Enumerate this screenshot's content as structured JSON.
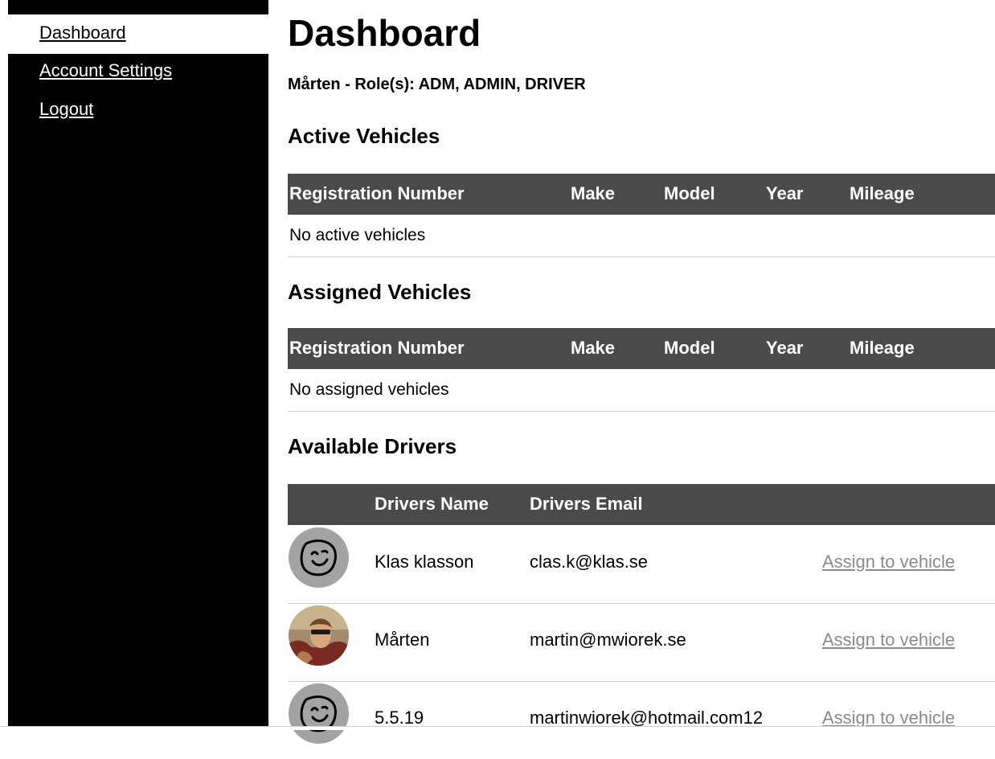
{
  "sidebar": {
    "items": [
      {
        "label": "Dashboard",
        "active": true
      },
      {
        "label": "Account Settings",
        "active": false
      },
      {
        "label": "Logout",
        "active": false
      }
    ]
  },
  "page": {
    "title": "Dashboard",
    "user_roles": "Mårten - Role(s): ADM, ADMIN, DRIVER"
  },
  "active_vehicles": {
    "heading": "Active Vehicles",
    "columns": [
      "Registration Number",
      "Make",
      "Model",
      "Year",
      "Mileage"
    ],
    "empty_text": "No active vehicles"
  },
  "assigned_vehicles": {
    "heading": "Assigned Vehicles",
    "columns": [
      "Registration Number",
      "Make",
      "Model",
      "Year",
      "Mileage"
    ],
    "empty_text": "No assigned vehicles"
  },
  "available_drivers": {
    "heading": "Available Drivers",
    "columns": [
      "",
      "Drivers Name",
      "Drivers Email",
      ""
    ],
    "rows": [
      {
        "avatar": "smiley-face-icon",
        "name": "Klas klasson",
        "email": "clas.k@klas.se",
        "action": "Assign to vehicle"
      },
      {
        "avatar": "user-photo",
        "name": "Mårten",
        "email": "martin@mwiorek.se",
        "action": "Assign to vehicle"
      },
      {
        "avatar": "smiley-face-icon",
        "name": "5.5.19",
        "email": "martinwiorek@hotmail.com12",
        "action": "Assign to vehicle"
      }
    ]
  },
  "colors": {
    "sidebar_bg": "#000000",
    "table_header_bg": "#4a4a4a",
    "link_muted": "#8a8a8a",
    "avatar_bg": "#a3a3a3"
  }
}
